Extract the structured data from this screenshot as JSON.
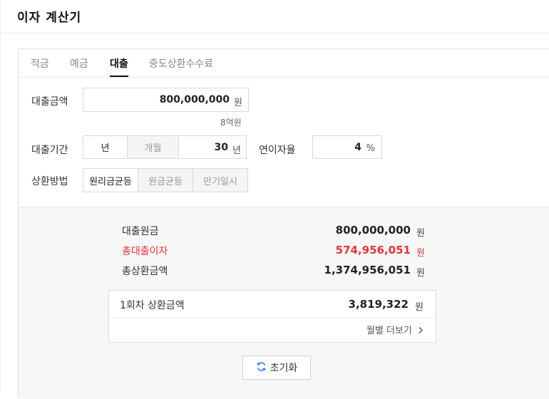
{
  "header": {
    "title": "이자 계산기"
  },
  "tabs": [
    {
      "label": "적금"
    },
    {
      "label": "예금"
    },
    {
      "label": "대출"
    },
    {
      "label": "중도상환수수료"
    }
  ],
  "form": {
    "amount": {
      "label": "대출금액",
      "value": "800,000,000",
      "unit": "원",
      "hint": "8억원"
    },
    "period": {
      "label": "대출기간",
      "seg_year": "년",
      "seg_month": "개월",
      "value": "30",
      "unit": "년"
    },
    "rate": {
      "label": "연이자율",
      "value": "4",
      "unit": "%"
    },
    "method": {
      "label": "상환방법",
      "options": [
        "원리금균등",
        "원금균등",
        "만기일시"
      ]
    }
  },
  "result": {
    "rows": [
      {
        "label": "대출원금",
        "value": "800,000,000",
        "unit": "원"
      },
      {
        "label": "총대출이자",
        "value": "574,956,051",
        "unit": "원"
      },
      {
        "label": "총상환금액",
        "value": "1,374,956,051",
        "unit": "원"
      }
    ],
    "first": {
      "label": "1회차 상환금액",
      "value": "3,819,322",
      "unit": "원",
      "more": "월별 더보기"
    },
    "reset": "초기화"
  },
  "colors": {
    "highlight": "#e8333b",
    "active_tab": "#111111"
  },
  "icons": {
    "reset": "refresh-icon",
    "more": "chevron-right-icon"
  }
}
